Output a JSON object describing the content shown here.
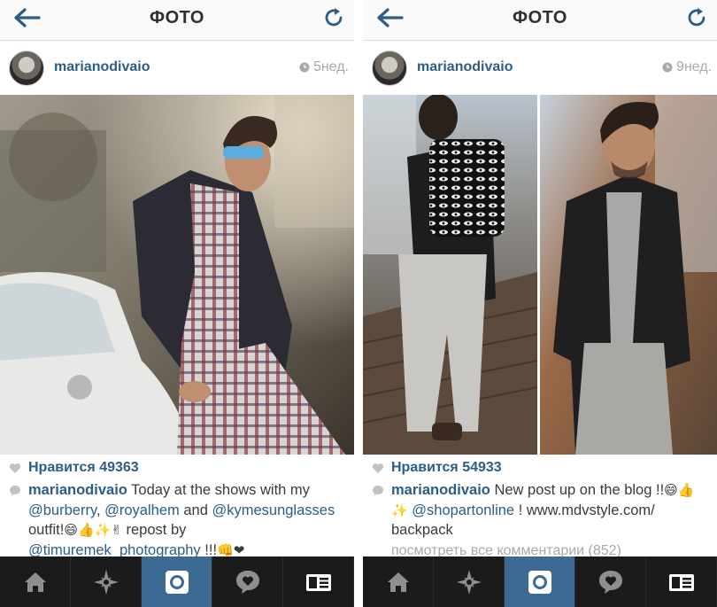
{
  "colors": {
    "accent": "#2c5d86",
    "header_bg": "#fafafa",
    "tabbar_bg": "#1b1b1b",
    "tab_active": "#3c6a93"
  },
  "screens": [
    {
      "header": {
        "title": "ФОТО",
        "back_icon": "back-arrow-icon",
        "refresh_icon": "refresh-icon"
      },
      "post": {
        "username": "marianodivaio",
        "time": "5нед.",
        "likes": "Нравится 49363",
        "caption": {
          "user": "marianodivaio",
          "t1": " Today at the shows with my ",
          "m1": "@burberry",
          "t2": ", ",
          "m2": "@royalhem",
          "t3": " and ",
          "m3": "@kymesunglasses",
          "t4": " outfit!",
          "e1": "😄👍✨✌",
          "t5": " repost by ",
          "m4": "@timuremek_photography",
          "t6": " !!!",
          "e2": "👊❤"
        }
      },
      "tabs": [
        "home-icon",
        "explore-icon",
        "camera-icon",
        "activity-icon",
        "profile-icon"
      ],
      "active_tab": 2
    },
    {
      "header": {
        "title": "ФОТО",
        "back_icon": "back-arrow-icon",
        "refresh_icon": "refresh-icon"
      },
      "post": {
        "username": "marianodivaio",
        "time": "9нед.",
        "likes": "Нравится 54933",
        "caption": {
          "user": "marianodivaio",
          "t1": " New post up on the blog !!",
          "e1": "😄👍✨",
          "t2": " ",
          "m1": "@shopartonline",
          "t3": " ! www.mdvstyle.com/ backpack"
        },
        "view_all": "посмотреть все комментарии (852)"
      },
      "tabs": [
        "home-icon",
        "explore-icon",
        "camera-icon",
        "activity-icon",
        "profile-icon"
      ],
      "active_tab": 2
    }
  ]
}
